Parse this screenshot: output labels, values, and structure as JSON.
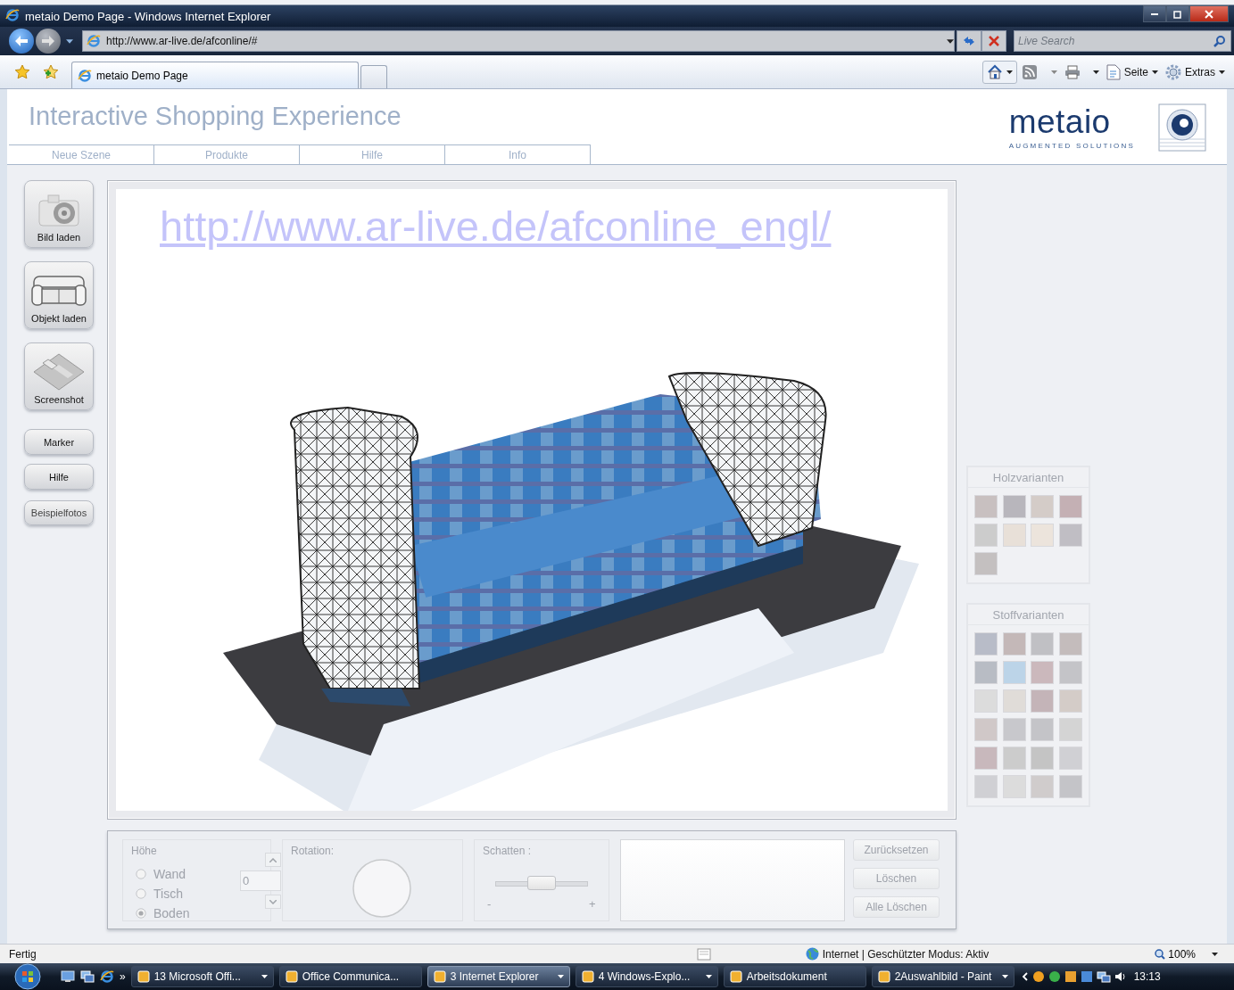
{
  "window": {
    "title": "metaio Demo Page - Windows Internet Explorer"
  },
  "address_bar": {
    "url": "http://www.ar-live.de/afconline/#"
  },
  "search": {
    "placeholder": "Live Search"
  },
  "tabs": [
    {
      "label": "metaio Demo Page",
      "selected": true
    }
  ],
  "command_bar": [
    {
      "label": "Seite",
      "kind": "page"
    },
    {
      "label": "Extras",
      "kind": "gear"
    }
  ],
  "page": {
    "title": "Interactive Shopping Experience",
    "logo": {
      "name": "metaio",
      "tagline": "AUGMENTED SOLUTIONS"
    },
    "nav": [
      "Neue Szene",
      "Produkte",
      "Hilfe",
      "Info"
    ],
    "tools": [
      {
        "label": "Bild laden",
        "kind": "camera"
      },
      {
        "label": "Objekt laden",
        "kind": "sofa"
      },
      {
        "label": "Screenshot",
        "kind": "disk"
      },
      {
        "label": "Marker",
        "kind": "plain"
      },
      {
        "label": "Hilfe",
        "kind": "plain"
      },
      {
        "label": "Beispielfotos",
        "kind": "small"
      }
    ],
    "viewer": {
      "link": "http://www.ar-live.de/afconline_engl/",
      "kind": "picture"
    },
    "wood": {
      "title": "Holzvarianten",
      "swatches": [
        {
          "color": "#c8c0c0"
        },
        {
          "color": "#b8b6bc"
        },
        {
          "color": "#d4ccc8"
        },
        {
          "color": "#c4b0b4"
        },
        {
          "color": "#cccccc"
        },
        {
          "color": "#e8e0d8"
        },
        {
          "color": "#ece4dc"
        },
        {
          "color": "#c0bec4"
        },
        {
          "color": "#c4c0c0"
        }
      ]
    },
    "fabric": {
      "title": "Stoffvarianten",
      "swatches": [
        {
          "color": "#b8bcc8"
        },
        {
          "color": "#c4b8b8"
        },
        {
          "color": "#c0c0c4"
        },
        {
          "color": "#c4bcbc"
        },
        {
          "color": "#b8bcc4"
        },
        {
          "color": "#bcd4e8"
        },
        {
          "color": "#cbb8bc"
        },
        {
          "color": "#c4c4c8"
        },
        {
          "color": "#dcdcdc"
        },
        {
          "color": "#e0dcd8"
        },
        {
          "color": "#c4b4b8"
        },
        {
          "color": "#d4ccc8"
        },
        {
          "color": "#d0c8c8"
        },
        {
          "color": "#c8c8cc"
        },
        {
          "color": "#c4c4c8"
        },
        {
          "color": "#d4d4d4"
        },
        {
          "color": "#c8b8bc"
        },
        {
          "color": "#cccccc"
        },
        {
          "color": "#c4c4c4"
        },
        {
          "color": "#d0d0d4"
        },
        {
          "color": "#d0d0d4"
        },
        {
          "color": "#dcdcdc"
        },
        {
          "color": "#d0cccc"
        },
        {
          "color": "#c4c4c8"
        }
      ]
    },
    "controls": {
      "disabled": true,
      "height": {
        "title": "Höhe",
        "value": "0",
        "options": [
          {
            "label": "Wand",
            "selected": false
          },
          {
            "label": "Tisch",
            "selected": false
          },
          {
            "label": "Boden",
            "selected": true
          }
        ]
      },
      "rotation": {
        "title": "Rotation:"
      },
      "shadow": {
        "title": "Schatten :",
        "level": 0.5,
        "min": "-",
        "max": "+"
      },
      "buttons": [
        "Zurücksetzen",
        "Löschen",
        "Alle Löschen"
      ]
    }
  },
  "status_bar": {
    "text": "Fertig",
    "zone": "Internet | Geschützter Modus: Aktiv",
    "zoom": "100%"
  },
  "taskbar": {
    "items": [
      {
        "label": "13 Microsoft Offi...",
        "kind": "group",
        "selected": false
      },
      {
        "label": "Office Communica...",
        "kind": "single",
        "selected": false
      },
      {
        "label": "3 Internet Explorer",
        "kind": "group",
        "selected": true
      },
      {
        "label": "4 Windows-Explo...",
        "kind": "group",
        "selected": false
      },
      {
        "label": "Arbeitsdokument",
        "kind": "single",
        "selected": false
      },
      {
        "label": "2Auswahlbild - Paint",
        "kind": "group",
        "selected": false
      }
    ],
    "more": "»",
    "clock": "13:13"
  }
}
